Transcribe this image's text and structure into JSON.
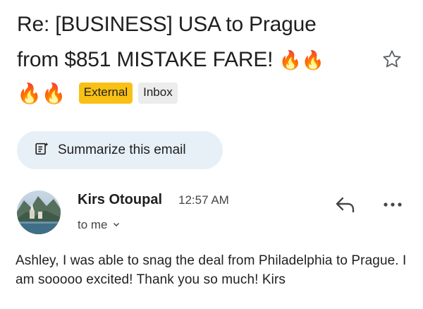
{
  "email": {
    "subject_line1": "Re: [BUSINESS] USA to Prague",
    "subject_line2": "from $851 MISTAKE FARE!",
    "fire_pair": "🔥🔥",
    "labels": [
      "External",
      "Inbox"
    ]
  },
  "summarize": {
    "label": "Summarize this email"
  },
  "message": {
    "sender": "Kirs Otoupal",
    "time": "12:57 AM",
    "recipient": "to me",
    "body": "Ashley, I was able to snag the deal from Philadelphia to Prague. I am sooooo excited! Thank you so much! Kirs"
  },
  "icons": {
    "star": "star-outline-icon",
    "summarize": "summarize-sparkle-icon",
    "reply": "reply-icon",
    "more": "more-horizontal-icon",
    "expand": "chevron-down-icon"
  }
}
